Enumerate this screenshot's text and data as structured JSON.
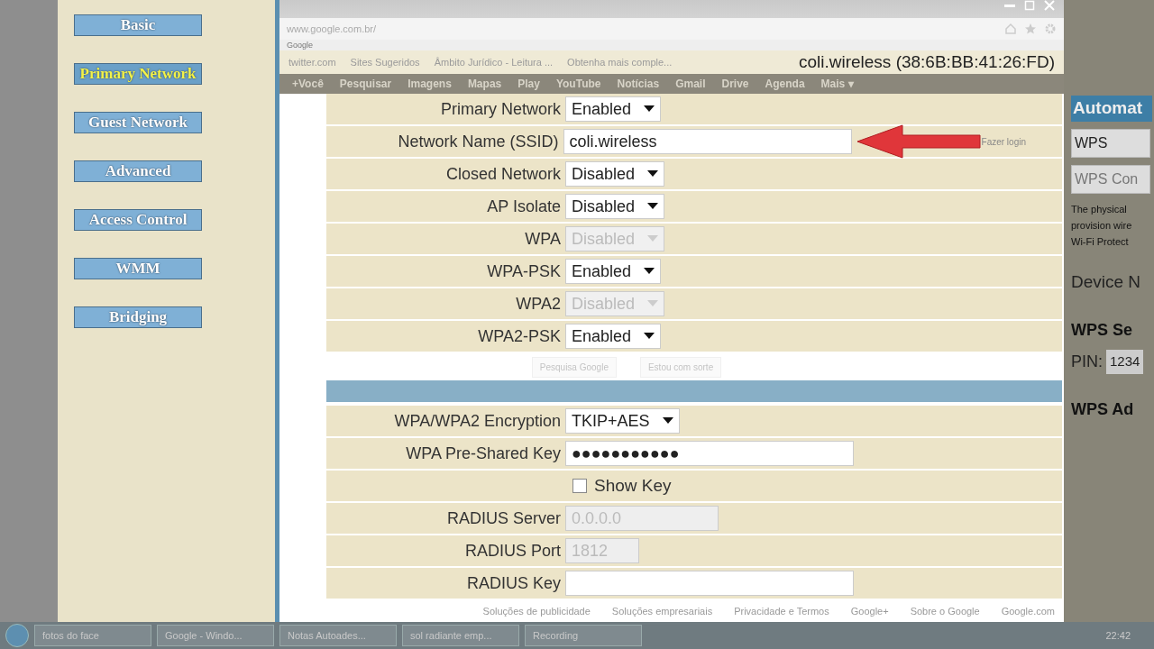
{
  "window": {
    "title": "coli.wireless (38:6B:BB:41:26:FD)"
  },
  "browser": {
    "address": "www.google.com.br/",
    "tab": "Google",
    "bookmarks": [
      "twitter.com",
      "Sites Sugeridos",
      "Âmbito Jurídico - Leitura ...",
      "Obtenha mais comple..."
    ],
    "google_nav": [
      "+Você",
      "Pesquisar",
      "Imagens",
      "Mapas",
      "Play",
      "YouTube",
      "Notícias",
      "Gmail",
      "Drive",
      "Agenda",
      "Mais ▾"
    ],
    "sign_in": "Fazer login",
    "search_buttons": [
      "Pesquisa Google",
      "Estou com sorte"
    ],
    "footer_links": [
      "Soluções de publicidade",
      "Soluções empresariais",
      "Privacidade e Termos",
      "Google+",
      "Sobre o Google",
      "Google.com"
    ]
  },
  "sidebar": {
    "items": [
      {
        "label": "Basic",
        "selected": false
      },
      {
        "label": "Primary Network",
        "selected": true
      },
      {
        "label": "Guest Network",
        "selected": false
      },
      {
        "label": "Advanced",
        "selected": false
      },
      {
        "label": "Access Control",
        "selected": false
      },
      {
        "label": "WMM",
        "selected": false
      },
      {
        "label": "Bridging",
        "selected": false
      }
    ]
  },
  "form": {
    "sections": [
      {
        "rows": [
          {
            "kind": "select",
            "label": "Primary Network",
            "value": "Enabled",
            "disabled": false
          },
          {
            "kind": "text",
            "label": "Network Name (SSID)",
            "value": "coli.wireless",
            "disabled": false,
            "arrow": true
          },
          {
            "kind": "select",
            "label": "Closed Network",
            "value": "Disabled",
            "disabled": false
          },
          {
            "kind": "select",
            "label": "AP Isolate",
            "value": "Disabled",
            "disabled": false
          },
          {
            "kind": "select",
            "label": "WPA",
            "value": "Disabled",
            "disabled": true
          },
          {
            "kind": "select",
            "label": "WPA-PSK",
            "value": "Enabled",
            "disabled": false
          },
          {
            "kind": "select",
            "label": "WPA2",
            "value": "Disabled",
            "disabled": true
          },
          {
            "kind": "select",
            "label": "WPA2-PSK",
            "value": "Enabled",
            "disabled": false
          }
        ]
      },
      {
        "rows": [
          {
            "kind": "select",
            "label": "WPA/WPA2 Encryption",
            "value": "TKIP+AES",
            "disabled": false
          },
          {
            "kind": "text",
            "label": "WPA Pre-Shared Key",
            "value": "●●●●●●●●●●●",
            "disabled": false
          },
          {
            "kind": "checkbox",
            "label": "Show Key",
            "checked": false
          },
          {
            "kind": "text",
            "label": "RADIUS Server",
            "value": "0.0.0.0",
            "disabled": true
          },
          {
            "kind": "text",
            "label": "RADIUS Port",
            "value": "1812",
            "disabled": true
          },
          {
            "kind": "text",
            "label": "RADIUS Key",
            "value": "",
            "disabled": false
          }
        ]
      }
    ]
  },
  "wps_panel": {
    "header": "Automat",
    "select": "WPS",
    "input_placeholder": "WPS Con",
    "text_lines": [
      "The physical",
      "provision wire",
      "Wi-Fi Protect"
    ],
    "device_label": "Device N",
    "settings_header": "WPS Se",
    "pin_label": "PIN:",
    "pin_value": "1234",
    "add_header": "WPS Ad"
  },
  "taskbar": {
    "items": [
      "fotos do face",
      "Google - Windo...",
      "Notas Autoades...",
      "sol radiante emp...",
      "Recording"
    ],
    "clock": "22:42"
  }
}
